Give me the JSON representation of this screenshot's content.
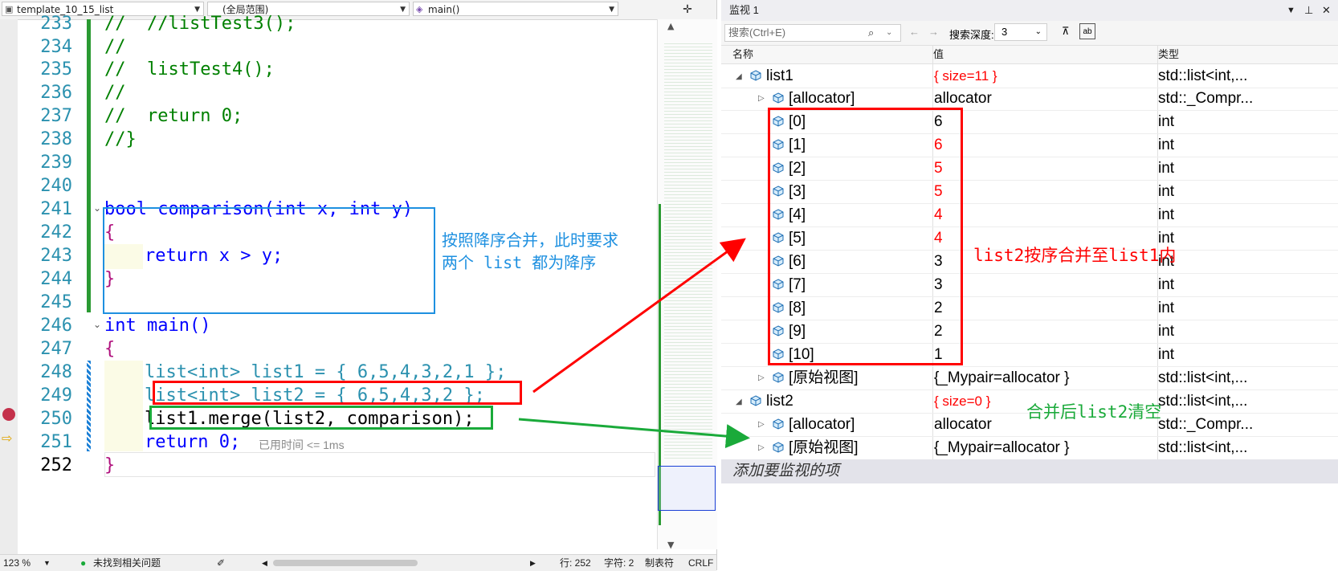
{
  "editor": {
    "nav": {
      "file": "template_10_15_list",
      "scope": "(全局范围)",
      "member": "main()"
    },
    "lines": [
      {
        "num": "233",
        "text": "//  //listTest3();"
      },
      {
        "num": "234",
        "text": "//"
      },
      {
        "num": "235",
        "text": "//  listTest4();"
      },
      {
        "num": "236",
        "text": "//"
      },
      {
        "num": "237",
        "text": "//  return 0;"
      },
      {
        "num": "238",
        "text": "//}"
      },
      {
        "num": "239",
        "text": ""
      },
      {
        "num": "240",
        "text": ""
      },
      {
        "num": "241",
        "text": "bool comparison(int x, int y)"
      },
      {
        "num": "242",
        "text": "{"
      },
      {
        "num": "243",
        "text": "return x > y;"
      },
      {
        "num": "244",
        "text": "}"
      },
      {
        "num": "245",
        "text": ""
      },
      {
        "num": "246",
        "text": "int main()"
      },
      {
        "num": "247",
        "text": "{"
      },
      {
        "num": "248",
        "text": "list<int> list1 = { 6,5,4,3,2,1 };"
      },
      {
        "num": "249",
        "text": "list<int> list2 = { 6,5,4,3,2 };"
      },
      {
        "num": "250",
        "text": "list1.merge(list2, comparison);"
      },
      {
        "num": "251",
        "text": "return 0;"
      },
      {
        "num": "252",
        "text": "}"
      }
    ],
    "perf_hint": "已用时间 <= 1ms",
    "annotation_blue": {
      "line1": "按照降序合并，此时要求",
      "line2": "两个 list 都为降序"
    }
  },
  "statusbar": {
    "zoom": "123 %",
    "issues": "未找到相关问题",
    "row": "行: 252",
    "col": "字符: 2",
    "tab": "制表符",
    "eol": "CRLF"
  },
  "watch": {
    "title": "监视 1",
    "search_placeholder": "搜索(Ctrl+E)",
    "depth_label": "搜索深度:",
    "depth_value": "3",
    "columns": {
      "name": "名称",
      "value": "值",
      "type": "类型"
    },
    "rows": [
      {
        "name": "list1",
        "value": "{ size=11 }",
        "type": "std::list<int,...",
        "red": true
      },
      {
        "name": "[allocator]",
        "value": "allocator",
        "type": "std::_Compr...",
        "red": false
      },
      {
        "name": "[0]",
        "value": "6",
        "type": "int",
        "red": false
      },
      {
        "name": "[1]",
        "value": "6",
        "type": "int",
        "red": true
      },
      {
        "name": "[2]",
        "value": "5",
        "type": "int",
        "red": true
      },
      {
        "name": "[3]",
        "value": "5",
        "type": "int",
        "red": true
      },
      {
        "name": "[4]",
        "value": "4",
        "type": "int",
        "red": true
      },
      {
        "name": "[5]",
        "value": "4",
        "type": "int",
        "red": true
      },
      {
        "name": "[6]",
        "value": "3",
        "type": "int",
        "red": false
      },
      {
        "name": "[7]",
        "value": "3",
        "type": "int",
        "red": false
      },
      {
        "name": "[8]",
        "value": "2",
        "type": "int",
        "red": false
      },
      {
        "name": "[9]",
        "value": "2",
        "type": "int",
        "red": false
      },
      {
        "name": "[10]",
        "value": "1",
        "type": "int",
        "red": false
      },
      {
        "name": "[原始视图]",
        "value": "{_Mypair=allocator }",
        "type": "std::list<int,...",
        "red": false
      },
      {
        "name": "list2",
        "value": "{ size=0 }",
        "type": "std::list<int,...",
        "red": true
      },
      {
        "name": "[allocator]",
        "value": "allocator",
        "type": "std::_Compr...",
        "red": false
      },
      {
        "name": "[原始视图]",
        "value": "{_Mypair=allocator }",
        "type": "std::list<int,...",
        "red": false
      }
    ],
    "add_item": "添加要监视的项",
    "note_red": "list2按序合并至list1内",
    "note_green": "合并后list2清空"
  },
  "colors": {
    "red": "#ff0000",
    "green": "#1aaa3a",
    "blue": "#1e90e0"
  }
}
